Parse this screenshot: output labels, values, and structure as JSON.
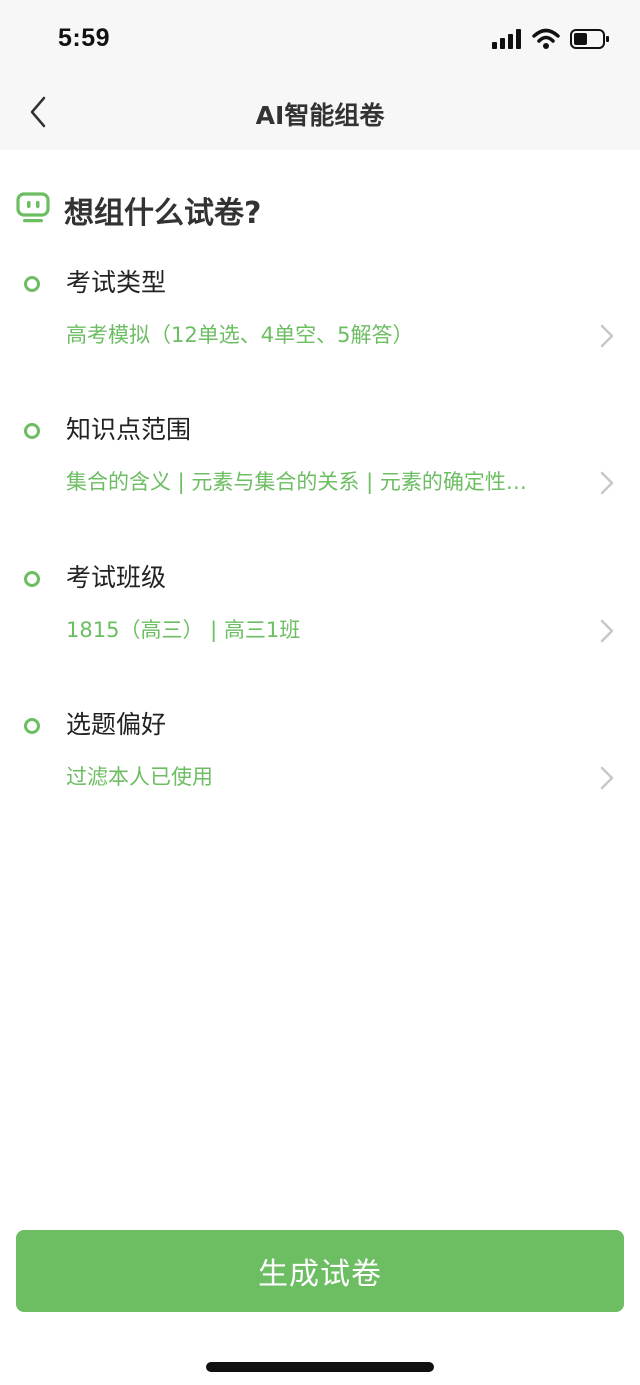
{
  "status_bar": {
    "time": "5:59"
  },
  "nav": {
    "title": "AI智能组卷"
  },
  "heading": "想组什么试卷?",
  "sections": [
    {
      "title": "考试类型",
      "value": "高考模拟（12单选、4单空、5解答）"
    },
    {
      "title": "知识点范围",
      "value": "集合的含义 | 元素与集合的关系 | 元素的确定性…"
    },
    {
      "title": "考试班级",
      "value": "1815（高三） | 高三1班"
    },
    {
      "title": "选题偏好",
      "value": "过滤本人已使用"
    }
  ],
  "generate_button": "生成试卷",
  "icons": {
    "back": "chevron-left-icon",
    "robot": "robot-icon",
    "row_arrow": "chevron-right-icon",
    "signal": "cellular-signal-icon",
    "wifi": "wifi-icon",
    "battery": "battery-icon"
  },
  "colors": {
    "accent": "#6dbd63",
    "header_bg": "#f7f7f7",
    "text_primary": "#222222",
    "chevron": "#c7c7cc"
  }
}
